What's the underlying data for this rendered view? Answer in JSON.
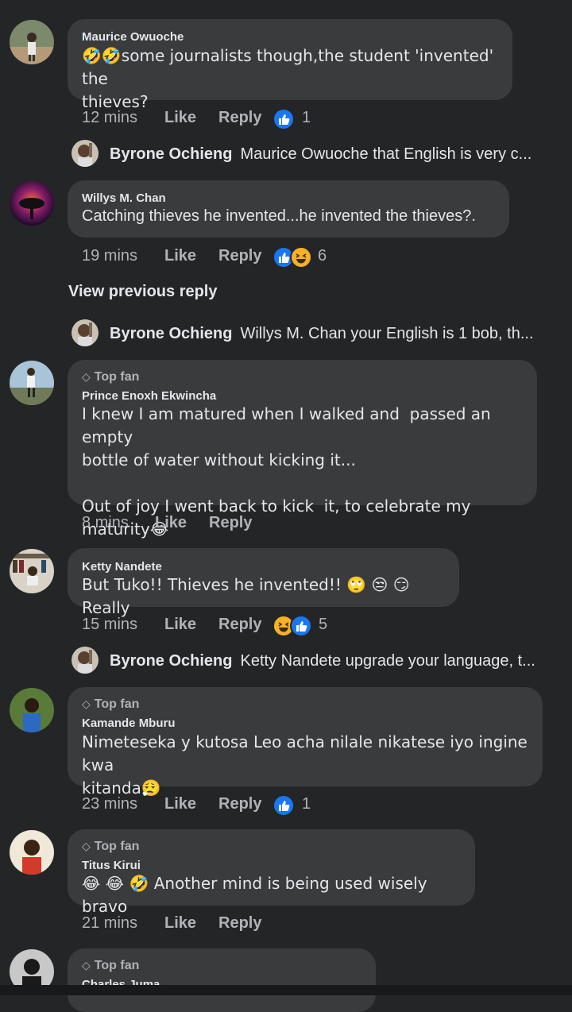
{
  "comments": [
    {
      "name": "Maurice Owuoche",
      "text": "🤣🤣some journalists though,the student 'invented' the\nthieves?",
      "time": "12 mins",
      "like": "Like",
      "reply": "Reply",
      "reaction_count": "1",
      "reactions": [
        "like-icon"
      ]
    },
    {
      "name": "Willys M. Chan",
      "text": "Catching thieves he invented...he invented the thieves?.",
      "time": "19 mins",
      "like": "Like",
      "reply": "Reply",
      "reaction_count": "6",
      "reactions": [
        "like-icon",
        "haha-icon"
      ]
    },
    {
      "top_fan": "Top fan",
      "name": "Prince Enoxh Ekwincha",
      "text": "I knew I am matured when I walked and  passed an empty\nbottle of water without kicking it...\n\nOut of joy I went back to kick  it, to celebrate my maturity😂",
      "time": "8 mins",
      "like": "Like",
      "reply": "Reply"
    },
    {
      "name": "Ketty Nandete",
      "text": "But Tuko!! Thieves he invented!! 🙄 😒 😏 Really",
      "time": "15 mins",
      "like": "Like",
      "reply": "Reply",
      "reaction_count": "5",
      "reactions": [
        "haha-icon",
        "like-icon"
      ]
    },
    {
      "top_fan": "Top fan",
      "name": "Kamande Mburu",
      "text": "Nimeteseka y kutosa Leo acha nilale nikatese iyo ingine kwa\nkitanda😮‍💨",
      "time": "23 mins",
      "like": "Like",
      "reply": "Reply",
      "reaction_count": "1",
      "reactions": [
        "like-icon"
      ]
    },
    {
      "top_fan": "Top fan",
      "name": "Titus Kirui",
      "text": "😂 😂 🤣 Another mind is being used wisely bravo",
      "time": "21 mins",
      "like": "Like",
      "reply": "Reply"
    },
    {
      "top_fan": "Top fan",
      "name": "Charles Juma"
    }
  ],
  "replies": [
    {
      "name": "Byrone Ochieng",
      "text": "Maurice Owuoche that English is very c..."
    },
    {
      "name": "Byrone Ochieng",
      "text": "Willys M. Chan your English is 1 bob, th..."
    },
    {
      "name": "Byrone Ochieng",
      "text": "Ketty Nandete upgrade your language, t..."
    }
  ],
  "view_previous_reply": "View previous reply",
  "colors": {
    "background": "#242526",
    "bubble": "#3a3b3c",
    "secondary_text": "#b0b3b8",
    "like_blue": "#1877f2",
    "haha_yellow": "#f7b125"
  }
}
